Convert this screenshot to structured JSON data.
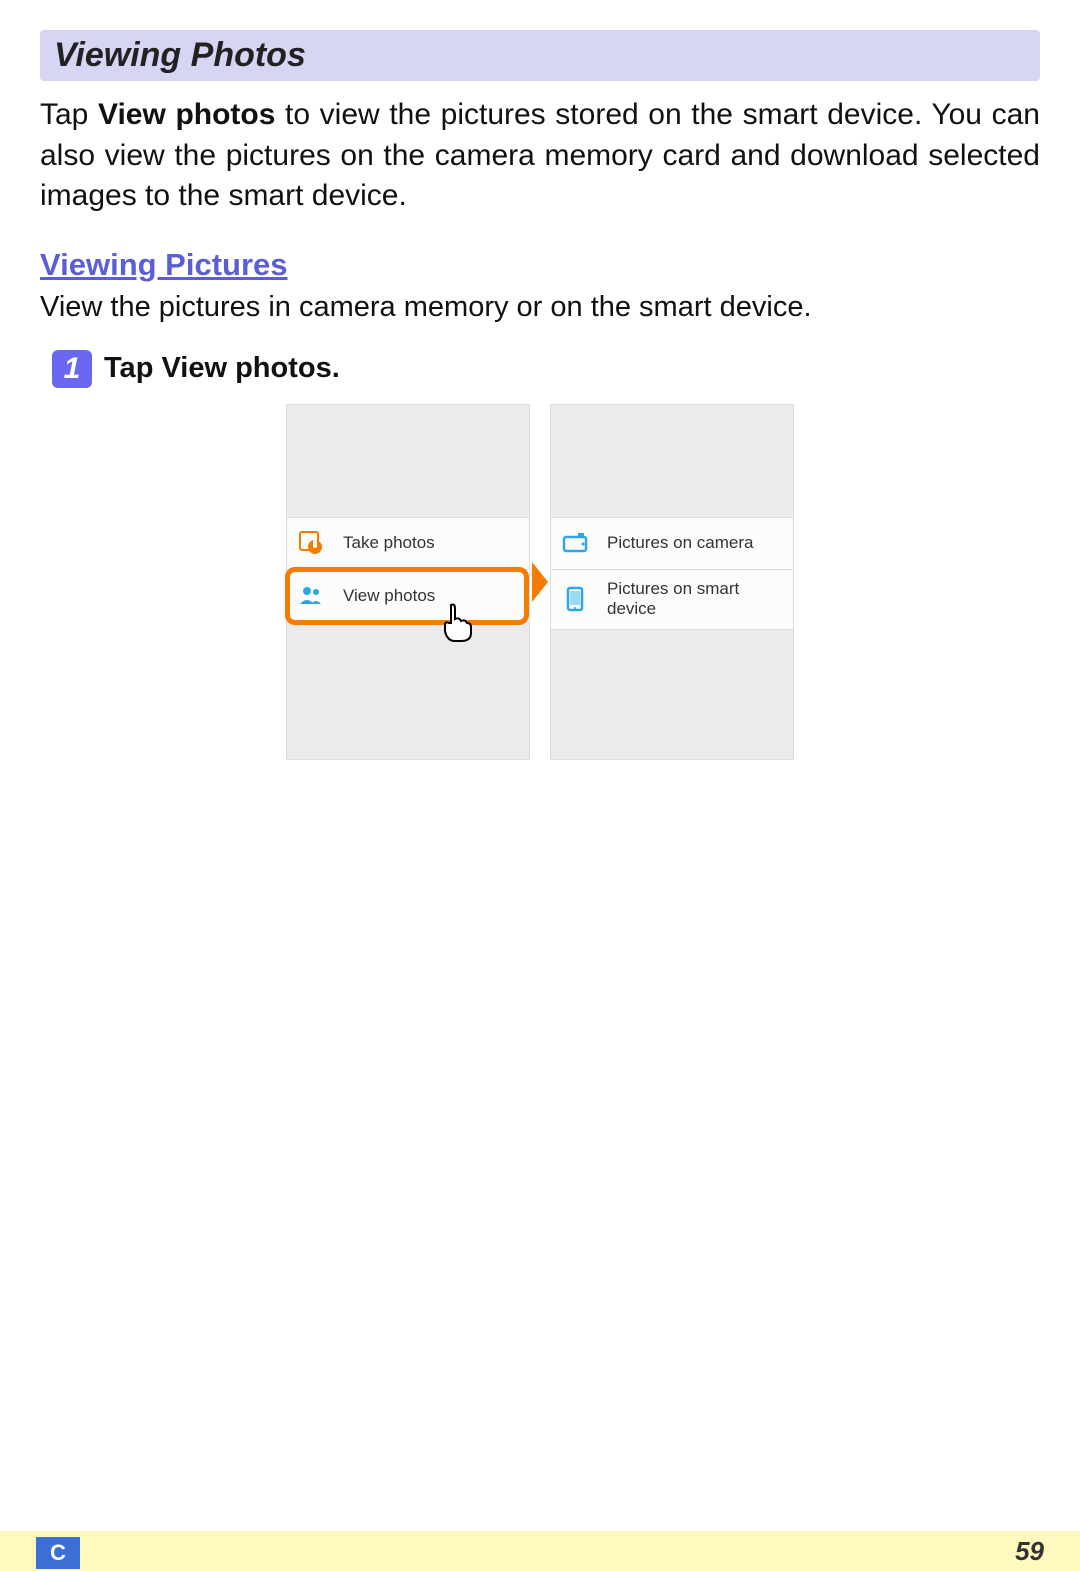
{
  "section_title": "Viewing Photos",
  "intro": {
    "prefix": "Tap ",
    "bold": "View photos",
    "suffix": " to view the pictures stored on the smart device. You can also view the pictures on the camera memory card and download selected images to the smart device."
  },
  "sub_heading": "Viewing Pictures",
  "sub_text": "View the pictures in camera memory or on the smart device.",
  "step": {
    "number": "1",
    "prefix": "Tap ",
    "bold": "View photos",
    "suffix": "."
  },
  "left_screen": {
    "items": [
      {
        "label": "Take photos",
        "icon": "camera-tap-icon"
      },
      {
        "label": "View photos",
        "icon": "people-icon"
      }
    ]
  },
  "right_screen": {
    "items": [
      {
        "label": "Pictures on camera",
        "icon": "camera-device-icon"
      },
      {
        "label": "Pictures on smart device",
        "icon": "smart-device-icon"
      }
    ]
  },
  "footer": {
    "section_letter": "C",
    "page_number": "59"
  }
}
